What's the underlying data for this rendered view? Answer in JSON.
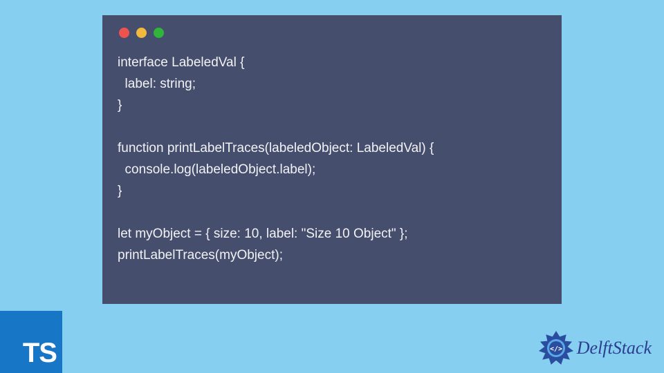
{
  "window_controls": {
    "red": "#ef5350",
    "yellow": "#f1b93d",
    "green": "#2eb53a"
  },
  "code": {
    "line1": "interface LabeledVal {",
    "line2": "  label: string;",
    "line3": "}",
    "line4": "",
    "line5": "function printLabelTraces(labeledObject: LabeledVal) {",
    "line6": "  console.log(labeledObject.label);",
    "line7": "}",
    "line8": "",
    "line9": "let myObject = { size: 10, label: \"Size 10 Object\" };",
    "line10": "printLabelTraces(myObject);"
  },
  "badges": {
    "ts_label": "TS",
    "delft_label": "DelftStack"
  }
}
